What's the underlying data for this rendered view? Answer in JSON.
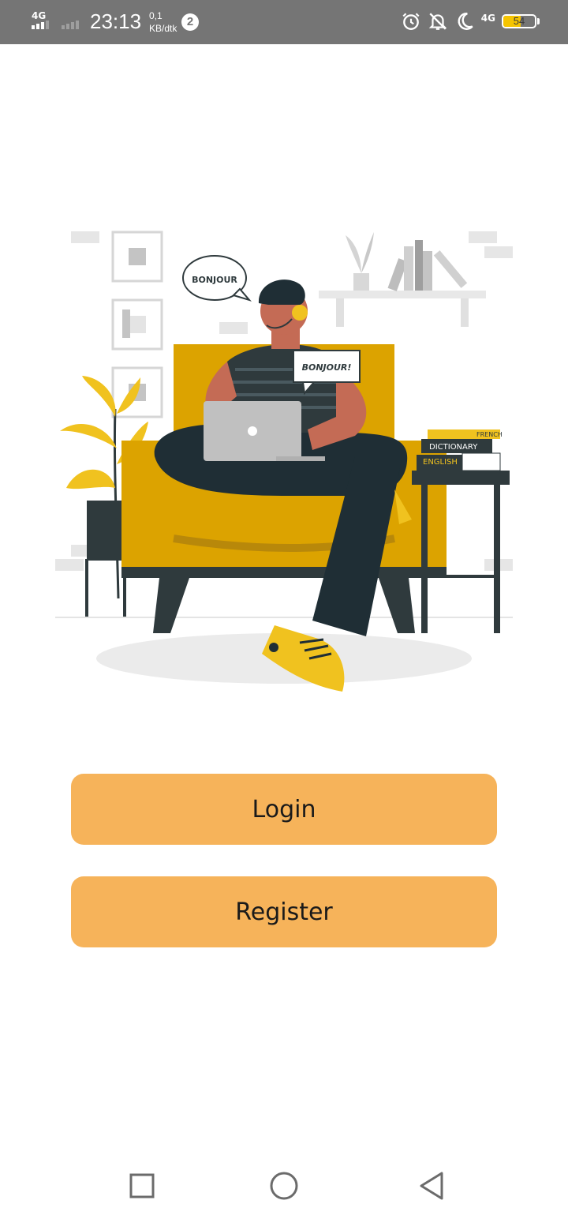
{
  "status_bar": {
    "network_label": "4G",
    "time": "23:13",
    "speed_value": "0,1",
    "speed_unit": "KB/dtk",
    "notification_count": "2",
    "mobile_data_label": "4G",
    "battery_percent": "54",
    "battery_level": 0.54,
    "battery_color": "#f5c400"
  },
  "illustration": {
    "speech_bubble_1": "BONJOUR",
    "speech_bubble_2": "BONJOUR!",
    "book_1": "FRENCH",
    "book_2": "DICTIONARY",
    "book_3": "ENGLISH"
  },
  "buttons": {
    "login": "Login",
    "register": "Register",
    "color": "#f6b35a"
  },
  "nav_bar": {
    "recent_icon": "square-icon",
    "home_icon": "circle-icon",
    "back_icon": "triangle-back-icon"
  }
}
